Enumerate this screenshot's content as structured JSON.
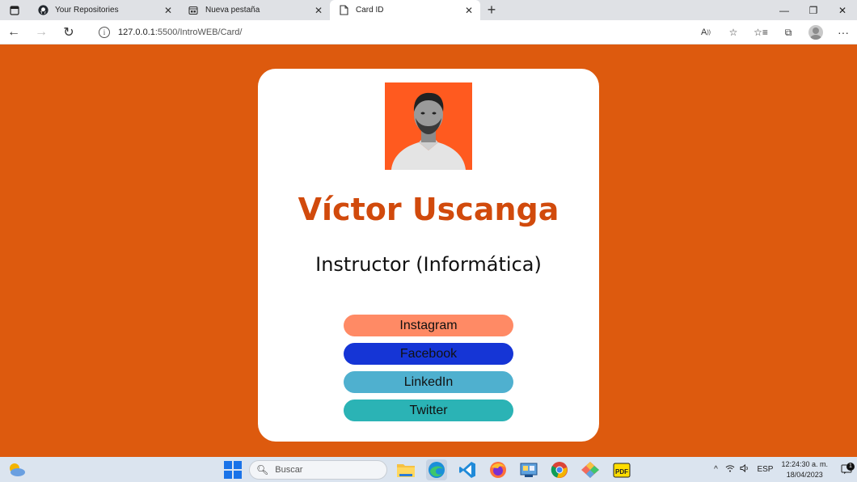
{
  "browser": {
    "tabs": [
      {
        "title": "Your Repositories",
        "icon": "github-icon",
        "active": false
      },
      {
        "title": "Nueva pestaña",
        "icon": "newtab-page-icon",
        "active": false
      },
      {
        "title": "Card ID",
        "icon": "document-icon",
        "active": true
      }
    ],
    "url_host": "127.0.0.1",
    "url_rest": ":5500/IntroWEB/Card/"
  },
  "card": {
    "name": "Víctor Uscanga",
    "role": "Instructor (Informática)",
    "links": {
      "instagram": "Instagram",
      "facebook": "Facebook",
      "linkedin": "LinkedIn",
      "twitter": "Twitter"
    },
    "colors": {
      "page_bg": "#dd5a0e",
      "name": "#d14a0c",
      "instagram": "#ff8a65",
      "facebook": "#1535d6",
      "linkedin": "#4fb0cf",
      "twitter": "#2bb3b5",
      "photo_bg": "#ff5a1f"
    }
  },
  "taskbar": {
    "search_placeholder": "Buscar",
    "language": "ESP",
    "time": "12:24:30 a. m.",
    "date": "18/04/2023",
    "notification_count": "1"
  }
}
